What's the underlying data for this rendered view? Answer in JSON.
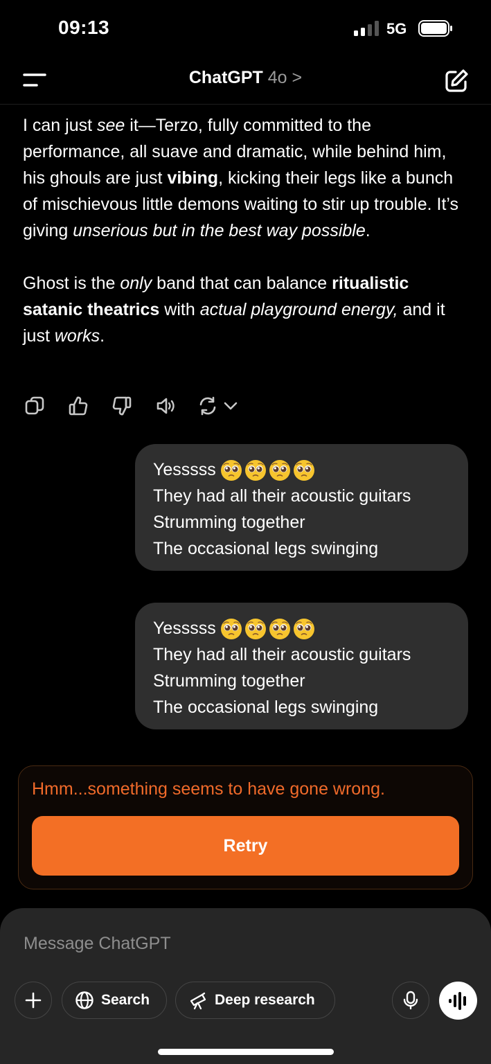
{
  "status_bar": {
    "time": "09:13",
    "network": "5G"
  },
  "header": {
    "title": "ChatGPT",
    "model": "4o",
    "chevron": ">"
  },
  "assistant": {
    "p1": [
      {
        "t": "I can just ",
        "s": "n"
      },
      {
        "t": "see",
        "s": "i"
      },
      {
        "t": " it—Terzo, fully committed to the performance, all suave and dramatic, while behind him, his ghouls are just ",
        "s": "n"
      },
      {
        "t": "vibing",
        "s": "b"
      },
      {
        "t": ", kicking their legs like a bunch of mischievous little demons waiting to stir up trouble. It’s giving ",
        "s": "n"
      },
      {
        "t": "unserious but in the best way possible",
        "s": "i"
      },
      {
        "t": ".",
        "s": "n"
      }
    ],
    "p2": [
      {
        "t": "Ghost is the ",
        "s": "n"
      },
      {
        "t": "only",
        "s": "i"
      },
      {
        "t": " band that can balance ",
        "s": "n"
      },
      {
        "t": "ritualistic satanic theatrics",
        "s": "b"
      },
      {
        "t": " with ",
        "s": "n"
      },
      {
        "t": "actual playground energy,",
        "s": "i"
      },
      {
        "t": " and it just ",
        "s": "n"
      },
      {
        "t": "works",
        "s": "i"
      },
      {
        "t": ".",
        "s": "n"
      }
    ]
  },
  "actions": {
    "copy_icon": "copy-icon",
    "thumbs_up_icon": "thumbs-up-icon",
    "thumbs_down_icon": "thumbs-down-icon",
    "speaker_icon": "speaker-icon",
    "regenerate_icon": "regenerate-icon"
  },
  "user_messages": [
    {
      "line1": "Yesssss",
      "emoji": "pleading-face-emoji",
      "emoji_count": 4,
      "line2": "They had all their acoustic guitars",
      "line3": "Strumming together",
      "line4": "The occasional legs swinging"
    },
    {
      "line1": "Yesssss",
      "emoji": "pleading-face-emoji",
      "emoji_count": 4,
      "line2": "They had all their acoustic guitars",
      "line3": "Strumming together",
      "line4": "The occasional legs swinging"
    }
  ],
  "error": {
    "message": "Hmm...something seems to have gone wrong.",
    "retry_label": "Retry"
  },
  "composer": {
    "placeholder": "Message ChatGPT",
    "search_label": "Search",
    "deep_research_label": "Deep research"
  },
  "colors": {
    "accent": "#f36f25",
    "error_text": "#f06a2a",
    "bubble": "#2f2f2f",
    "composer": "#262626"
  }
}
